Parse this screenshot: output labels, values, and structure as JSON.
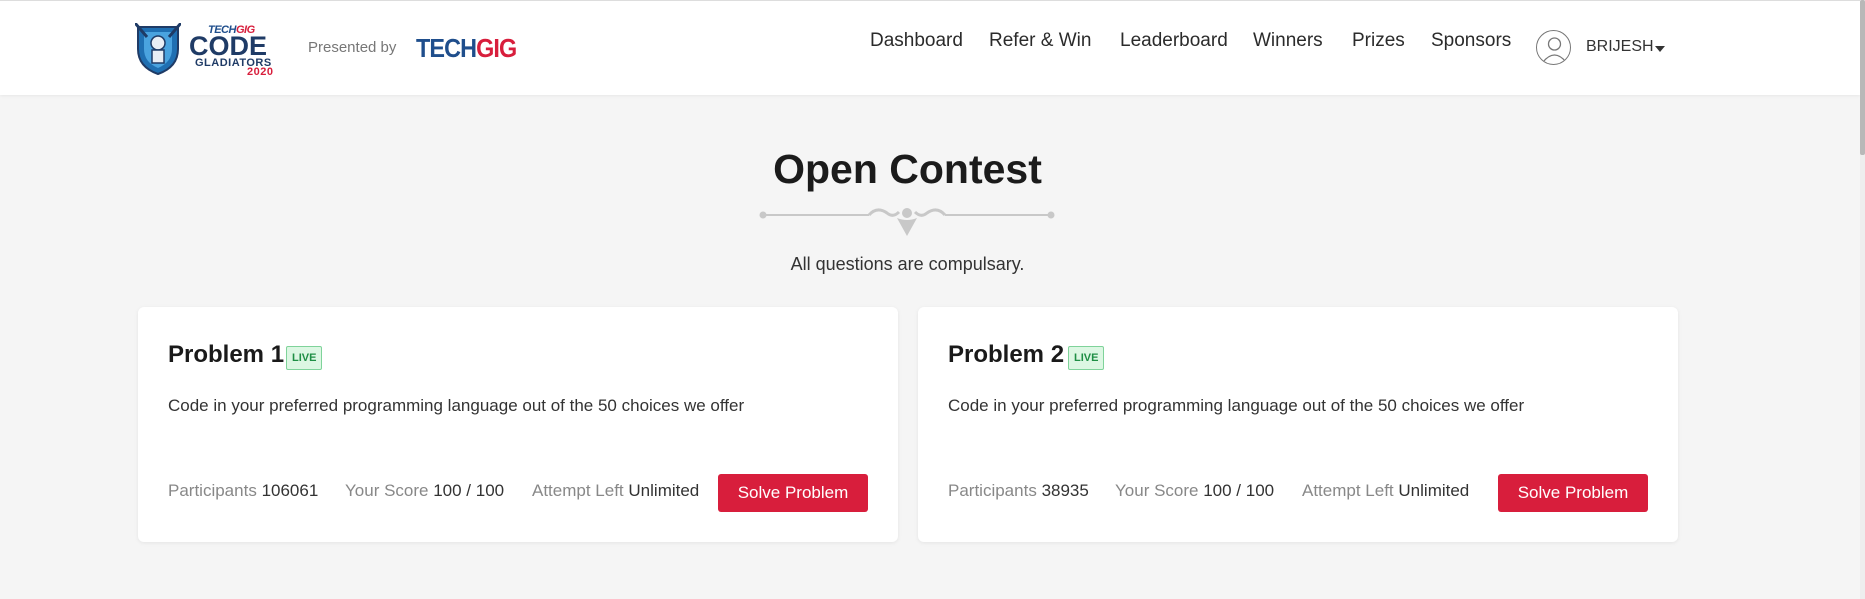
{
  "logo": {
    "tech": "TECH",
    "gig": "GIG",
    "code": "CODE",
    "gladiators": "GLADIATORS",
    "year": "2020"
  },
  "header": {
    "presented_by": "Presented by",
    "sponsor_brand_1": "TECH",
    "sponsor_brand_2": "GIG"
  },
  "nav": [
    {
      "label": "Dashboard"
    },
    {
      "label": "Refer & Win"
    },
    {
      "label": "Leaderboard"
    },
    {
      "label": "Winners"
    },
    {
      "label": "Prizes"
    },
    {
      "label": "Sponsors"
    }
  ],
  "user": {
    "name": "BRIJESH",
    "avatar_icon": "user-avatar-icon",
    "menu_icon": "caret-down-icon"
  },
  "page": {
    "title": "Open Contest",
    "subtitle": "All questions are compulsary."
  },
  "problems": [
    {
      "title": "Problem 1",
      "badge": "LIVE",
      "description": "Code in your preferred programming language out of the 50 choices we offer",
      "participants_label": "Participants",
      "participants": "106061",
      "score_label": "Your Score",
      "score": "100 / 100",
      "attempt_label": "Attempt Left",
      "attempt": "Unlimited",
      "button": "Solve Problem"
    },
    {
      "title": "Problem 2",
      "badge": "LIVE",
      "description": "Code in your preferred programming language out of the 50 choices we offer",
      "participants_label": "Participants",
      "participants": "38935",
      "score_label": "Your Score",
      "score": "100 / 100",
      "attempt_label": "Attempt Left",
      "attempt": "Unlimited",
      "button": "Solve Problem"
    }
  ],
  "colors": {
    "accent": "#d81e3c",
    "brand_blue": "#1f4e8c",
    "live_green": "#1f8f45",
    "background": "#f5f5f5"
  }
}
